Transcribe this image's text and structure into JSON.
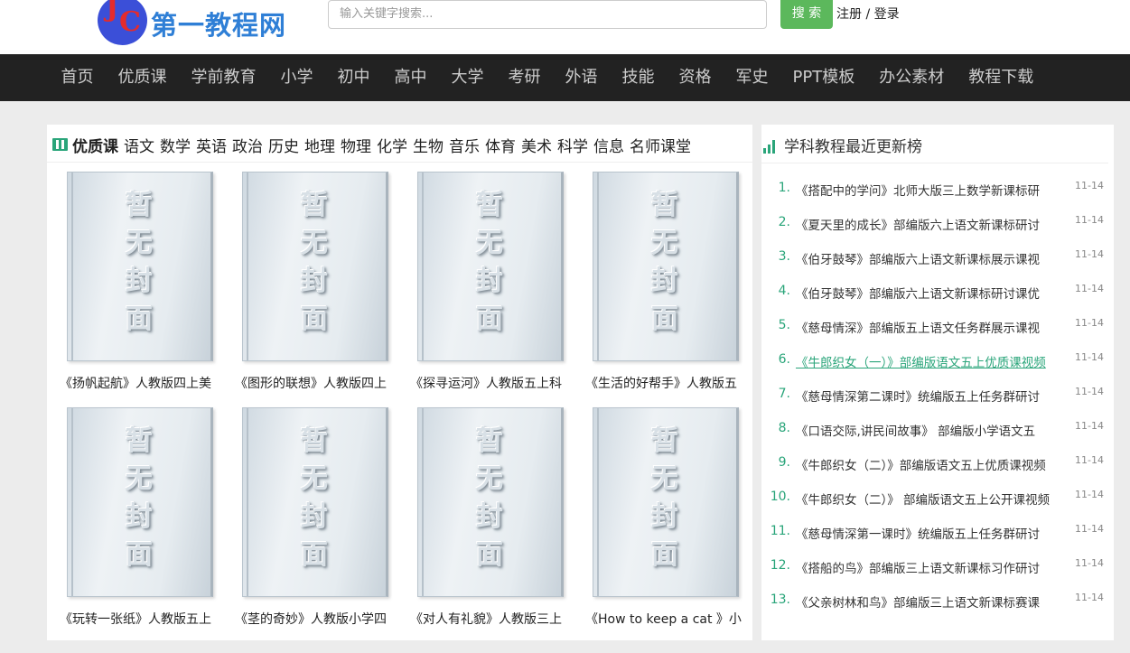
{
  "header": {
    "logo_text": "第一教程网",
    "search_placeholder": "输入关键字搜索...",
    "search_button": "搜 索",
    "register": "注册",
    "separator": " / ",
    "login": "登录"
  },
  "nav": [
    "首页",
    "优质课",
    "学前教育",
    "小学",
    "初中",
    "高中",
    "大学",
    "考研",
    "外语",
    "技能",
    "资格",
    "军史",
    "PPT模板",
    "办公素材",
    "教程下载"
  ],
  "category_bar": {
    "main": "优质课",
    "subs": [
      "语文",
      "数学",
      "英语",
      "政治",
      "历史",
      "地理",
      "物理",
      "化学",
      "生物",
      "音乐",
      "体育",
      "美术",
      "科学",
      "信息",
      "名师课堂"
    ]
  },
  "cover_placeholder": [
    "暂",
    "无",
    "封",
    "面"
  ],
  "courses": [
    {
      "title": "《扬帆起航》人教版四上美"
    },
    {
      "title": "《图形的联想》人教版四上"
    },
    {
      "title": "《探寻运河》人教版五上科"
    },
    {
      "title": "《生活的好帮手》人教版五"
    },
    {
      "title": "《玩转一张纸》人教版五上"
    },
    {
      "title": "《茎的奇妙》人教版小学四"
    },
    {
      "title": "《对人有礼貌》人教版三上"
    },
    {
      "title": "《How to keep a cat 》小"
    }
  ],
  "ranking": {
    "title": "学科教程最近更新榜",
    "items": [
      {
        "num": "1.",
        "title": "《搭配中的学问》北师大版三上数学新课标研",
        "date": "11-14"
      },
      {
        "num": "2.",
        "title": "《夏天里的成长》部编版六上语文新课标研讨",
        "date": "11-14"
      },
      {
        "num": "3.",
        "title": "《伯牙鼓琴》部编版六上语文新课标展示课视",
        "date": "11-14"
      },
      {
        "num": "4.",
        "title": "《伯牙鼓琴》部编版六上语文新课标研讨课优",
        "date": "11-14"
      },
      {
        "num": "5.",
        "title": "《慈母情深》部编版五上语文任务群展示课视",
        "date": "11-14"
      },
      {
        "num": "6.",
        "title": "《牛郎织女（一）》部编版语文五上优质课视频",
        "date": "11-14"
      },
      {
        "num": "7.",
        "title": "《慈母情深第二课时》统编版五上任务群研讨",
        "date": "11-14"
      },
      {
        "num": "8.",
        "title": "《口语交际,讲民间故事》 部编版小学语文五",
        "date": "11-14"
      },
      {
        "num": "9.",
        "title": "《牛郎织女（二）》部编版语文五上优质课视频",
        "date": "11-14"
      },
      {
        "num": "10.",
        "title": "《牛郎织女（二）》 部编版语文五上公开课视频",
        "date": "11-14"
      },
      {
        "num": "11.",
        "title": "《慈母情深第一课时》统编版五上任务群研讨",
        "date": "11-14"
      },
      {
        "num": "12.",
        "title": "《搭船的鸟》部编版三上语文新课标习作研讨",
        "date": "11-14"
      },
      {
        "num": "13.",
        "title": "《父亲树林和鸟》部编版三上语文新课标赛课",
        "date": "11-14"
      }
    ]
  }
}
